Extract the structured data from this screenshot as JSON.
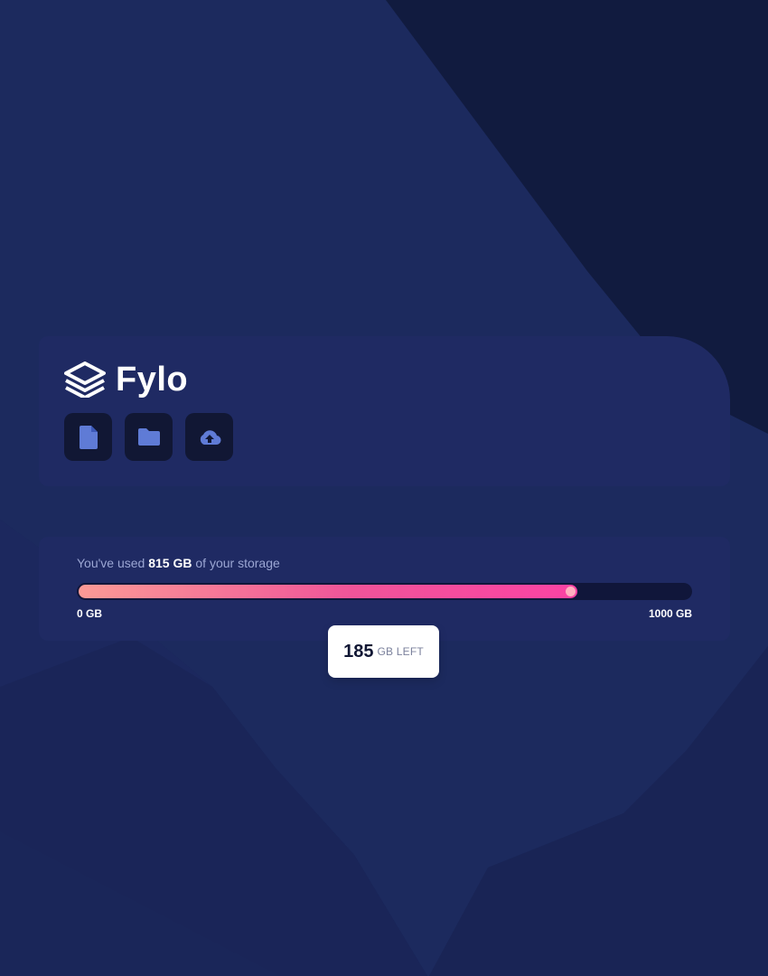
{
  "app": {
    "name": "Fylo"
  },
  "icons": {
    "logo": "stacked-layers-icon",
    "document": "document-icon",
    "folder": "folder-icon",
    "upload": "upload-cloud-icon"
  },
  "storage": {
    "prefix": "You've used ",
    "used": "815 GB",
    "suffix": " of your storage",
    "used_value": 815,
    "total_value": 1000,
    "min_label": "0 GB",
    "max_label": "1000 GB",
    "remaining_value": "185",
    "remaining_label": "GB LEFT"
  },
  "colors": {
    "background": "#1c2a5e",
    "card": "#1f2a63",
    "button_bg": "#111734",
    "icon": "#5f7bd6",
    "gradient_start": "#fb9a96",
    "gradient_end": "#fb43a4"
  }
}
